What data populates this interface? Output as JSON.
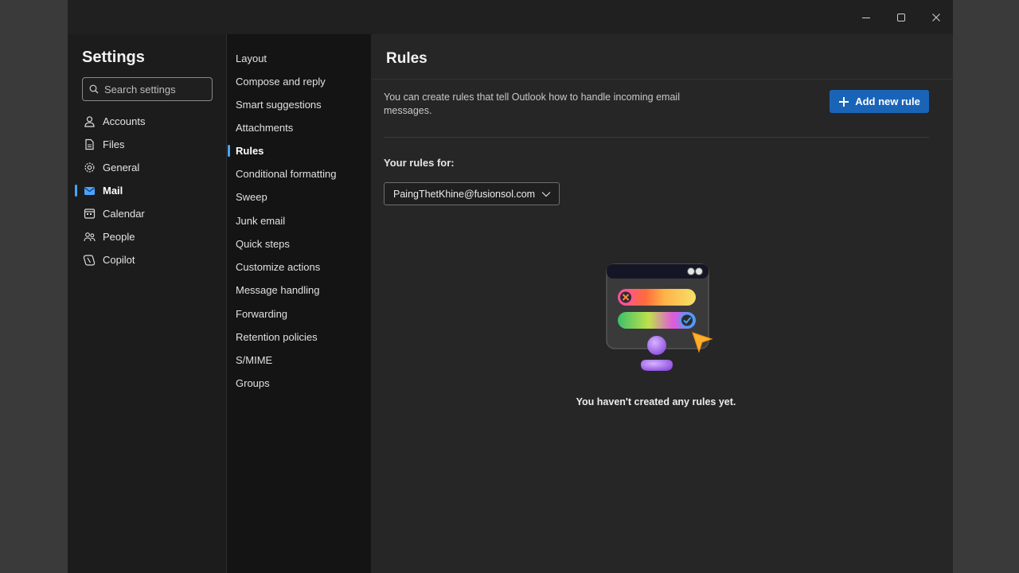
{
  "colors": {
    "accent": "#4aa3ff",
    "button": "#1a64b8",
    "background": "#262626"
  },
  "window": {
    "controls": [
      {
        "name": "minimize-icon"
      },
      {
        "name": "maximize-icon"
      },
      {
        "name": "close-icon"
      }
    ]
  },
  "settings": {
    "title": "Settings",
    "search_placeholder": "Search settings",
    "nav": [
      {
        "label": "Accounts",
        "icon": "person-icon"
      },
      {
        "label": "Files",
        "icon": "file-icon"
      },
      {
        "label": "General",
        "icon": "gear-icon"
      },
      {
        "label": "Mail",
        "icon": "mail-icon",
        "active": true
      },
      {
        "label": "Calendar",
        "icon": "calendar-icon"
      },
      {
        "label": "People",
        "icon": "people-icon"
      },
      {
        "label": "Copilot",
        "icon": "copilot-icon"
      }
    ]
  },
  "mail_nav": {
    "items": [
      {
        "label": "Layout"
      },
      {
        "label": "Compose and reply"
      },
      {
        "label": "Smart suggestions"
      },
      {
        "label": "Attachments"
      },
      {
        "label": "Rules",
        "active": true
      },
      {
        "label": "Conditional formatting"
      },
      {
        "label": "Sweep"
      },
      {
        "label": "Junk email"
      },
      {
        "label": "Quick steps"
      },
      {
        "label": "Customize actions"
      },
      {
        "label": "Message handling"
      },
      {
        "label": "Forwarding"
      },
      {
        "label": "Retention policies"
      },
      {
        "label": "S/MIME"
      },
      {
        "label": "Groups"
      }
    ]
  },
  "rules": {
    "title": "Rules",
    "description": "You can create rules that tell Outlook how to handle incoming email messages.",
    "add_button": "Add new rule",
    "your_rules_for": "Your rules for:",
    "account": "PaingThetKhine@fusionsol.com",
    "empty_message": "You haven't created any rules yet."
  }
}
